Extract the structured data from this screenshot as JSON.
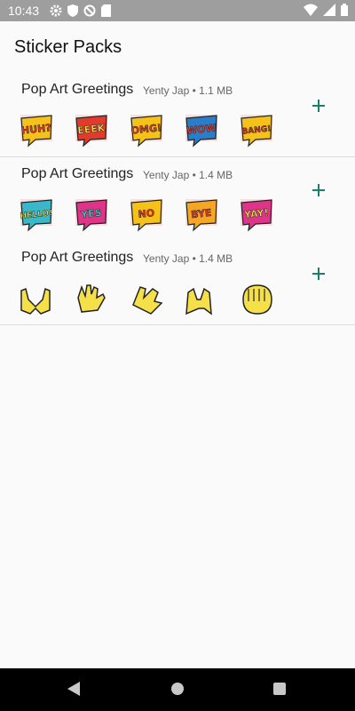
{
  "status_bar": {
    "time": "10:43",
    "icons": [
      "gear-icon",
      "shield-icon",
      "nosync-icon",
      "sdcard-icon",
      "wifi-icon",
      "signal-icon",
      "battery-icon"
    ]
  },
  "app": {
    "title": "Sticker Packs"
  },
  "packs": [
    {
      "name": "Pop Art Greetings",
      "meta": "Yenty Jap • 1.1 MB",
      "stickers": [
        {
          "text": "HUH?",
          "bg": "#e8e8e8",
          "fill": "#f6c21a",
          "txt": "#e23b2e"
        },
        {
          "text": "EEEK",
          "bg": "#e23b2e",
          "fill": "#e23b2e",
          "txt": "#f6e04a"
        },
        {
          "text": "OMG!",
          "bg": "#f6c21a",
          "fill": "#f6c21a",
          "txt": "#e23b2e"
        },
        {
          "text": "WOW",
          "bg": "#2a7dc8",
          "fill": "#2a7dc8",
          "txt": "#e23b2e"
        },
        {
          "text": "BANG!",
          "bg": "#f6c21a",
          "fill": "#f6c21a",
          "txt": "#e23b2e"
        }
      ]
    },
    {
      "name": "Pop Art Greetings",
      "meta": "Yenty Jap • 1.4 MB",
      "stickers": [
        {
          "text": "HELLO!",
          "bg": "#38b8c8",
          "fill": "#38b8c8",
          "txt": "#f6e04a"
        },
        {
          "text": "YES",
          "bg": "#e0338a",
          "fill": "#e0338a",
          "txt": "#3fd1c1"
        },
        {
          "text": "NO",
          "bg": "#f6c21a",
          "fill": "#f6c21a",
          "txt": "#e23b2e"
        },
        {
          "text": "BYE",
          "bg": "#f5a623",
          "fill": "#f5a623",
          "txt": "#e23b2e"
        },
        {
          "text": "YAY!",
          "bg": "#e0338a",
          "fill": "#e0338a",
          "txt": "#f6e04a"
        }
      ]
    },
    {
      "name": "Pop Art Greetings",
      "meta": "Yenty Jap • 1.4 MB",
      "stickers": [
        {
          "text": "",
          "bg": "#ffffff",
          "fill": "#f6e04a",
          "txt": "#000",
          "icon": "heart-hands-icon"
        },
        {
          "text": "",
          "bg": "#ffffff",
          "fill": "#f6e04a",
          "txt": "#000",
          "icon": "waving-hand-icon"
        },
        {
          "text": "",
          "bg": "#ffffff",
          "fill": "#f6e04a",
          "txt": "#000",
          "icon": "clapping-hands-icon"
        },
        {
          "text": "",
          "bg": "#ffffff",
          "fill": "#f6e04a",
          "txt": "#000",
          "icon": "raising-hands-icon"
        },
        {
          "text": "",
          "bg": "#ffffff",
          "fill": "#f6e04a",
          "txt": "#000",
          "icon": "fist-icon"
        }
      ]
    }
  ],
  "nav_bar": {
    "icons": [
      "back-icon",
      "home-icon",
      "recents-icon"
    ]
  }
}
